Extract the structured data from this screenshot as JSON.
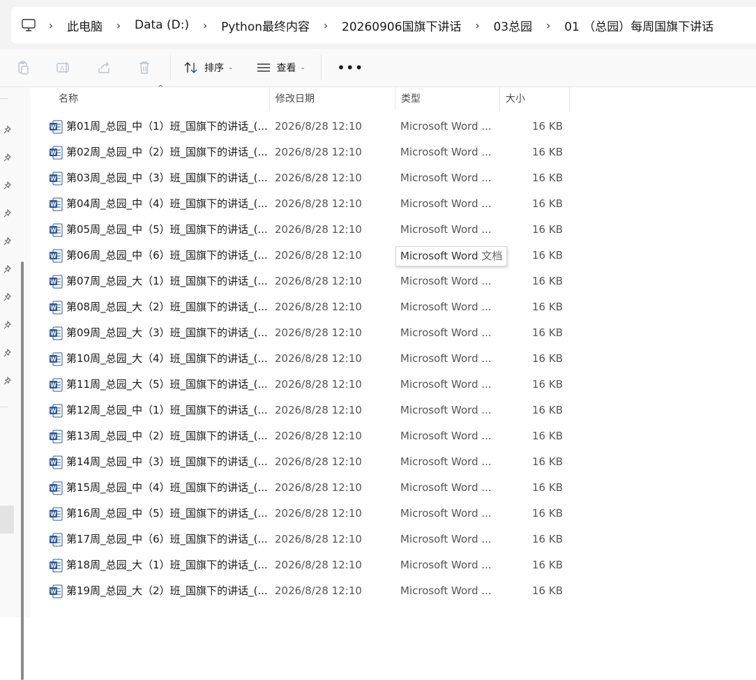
{
  "address": {
    "crumbs": [
      "此电脑",
      "Data (D:)",
      "Python最终内容",
      "20260906国旗下讲话",
      "03总园",
      "01 （总园）每周国旗下讲话"
    ]
  },
  "toolbar": {
    "sort_label": "排序",
    "view_label": "查看"
  },
  "columns": {
    "name": "名称",
    "date": "修改日期",
    "type": "类型",
    "size": "大小"
  },
  "files": [
    {
      "name": "第01周_总园_中（1）班_国旗下的讲话_(...",
      "date": "2026/8/28 12:10",
      "type": "Microsoft Word ...",
      "size": "16 KB"
    },
    {
      "name": "第02周_总园_中（2）班_国旗下的讲话_(...",
      "date": "2026/8/28 12:10",
      "type": "Microsoft Word ...",
      "size": "16 KB"
    },
    {
      "name": "第03周_总园_中（3）班_国旗下的讲话_(...",
      "date": "2026/8/28 12:10",
      "type": "Microsoft Word ...",
      "size": "16 KB"
    },
    {
      "name": "第04周_总园_中（4）班_国旗下的讲话_(...",
      "date": "2026/8/28 12:10",
      "type": "Microsoft Word ...",
      "size": "16 KB"
    },
    {
      "name": "第05周_总园_中（5）班_国旗下的讲话_(...",
      "date": "2026/8/28 12:10",
      "type": "Microsoft Word ...",
      "size": "16 KB"
    },
    {
      "name": "第06周_总园_中（6）班_国旗下的讲话_(...",
      "date": "2026/8/28 12:10",
      "type": "Microsoft Word ...",
      "size": "16 KB"
    },
    {
      "name": "第07周_总园_大（1）班_国旗下的讲话_(...",
      "date": "2026/8/28 12:10",
      "type": "Microsoft Word ...",
      "size": "16 KB"
    },
    {
      "name": "第08周_总园_大（2）班_国旗下的讲话_(...",
      "date": "2026/8/28 12:10",
      "type": "Microsoft Word ...",
      "size": "16 KB"
    },
    {
      "name": "第09周_总园_大（3）班_国旗下的讲话_(...",
      "date": "2026/8/28 12:10",
      "type": "Microsoft Word ...",
      "size": "16 KB"
    },
    {
      "name": "第10周_总园_大（4）班_国旗下的讲话_(...",
      "date": "2026/8/28 12:10",
      "type": "Microsoft Word ...",
      "size": "16 KB"
    },
    {
      "name": "第11周_总园_大（5）班_国旗下的讲话_(...",
      "date": "2026/8/28 12:10",
      "type": "Microsoft Word ...",
      "size": "16 KB"
    },
    {
      "name": "第12周_总园_中（1）班_国旗下的讲话_(...",
      "date": "2026/8/28 12:10",
      "type": "Microsoft Word ...",
      "size": "16 KB"
    },
    {
      "name": "第13周_总园_中（2）班_国旗下的讲话_(...",
      "date": "2026/8/28 12:10",
      "type": "Microsoft Word ...",
      "size": "16 KB"
    },
    {
      "name": "第14周_总园_中（3）班_国旗下的讲话_(...",
      "date": "2026/8/28 12:10",
      "type": "Microsoft Word ...",
      "size": "16 KB"
    },
    {
      "name": "第15周_总园_中（4）班_国旗下的讲话_(...",
      "date": "2026/8/28 12:10",
      "type": "Microsoft Word ...",
      "size": "16 KB"
    },
    {
      "name": "第16周_总园_中（5）班_国旗下的讲话_(...",
      "date": "2026/8/28 12:10",
      "type": "Microsoft Word ...",
      "size": "16 KB"
    },
    {
      "name": "第17周_总园_中（6）班_国旗下的讲话_(...",
      "date": "2026/8/28 12:10",
      "type": "Microsoft Word ...",
      "size": "16 KB"
    },
    {
      "name": "第18周_总园_大（1）班_国旗下的讲话_(...",
      "date": "2026/8/28 12:10",
      "type": "Microsoft Word ...",
      "size": "16 KB"
    },
    {
      "name": "第19周_总园_大（2）班_国旗下的讲话_(...",
      "date": "2026/8/28 12:10",
      "type": "Microsoft Word ...",
      "size": "16 KB"
    }
  ],
  "tooltip": {
    "text_en": "Microsoft Word",
    "text_zh": "文档"
  },
  "icons": {
    "address": "computer-icon",
    "copy": "copy-icon",
    "rename": "rename-icon",
    "share": "share-icon",
    "delete": "trash-icon",
    "sort": "sort-icon",
    "view": "view-icon",
    "more": "more-icon",
    "file": "word-file-icon",
    "pin": "pin-icon"
  },
  "colors": {
    "word_blue": "#2b579a"
  }
}
